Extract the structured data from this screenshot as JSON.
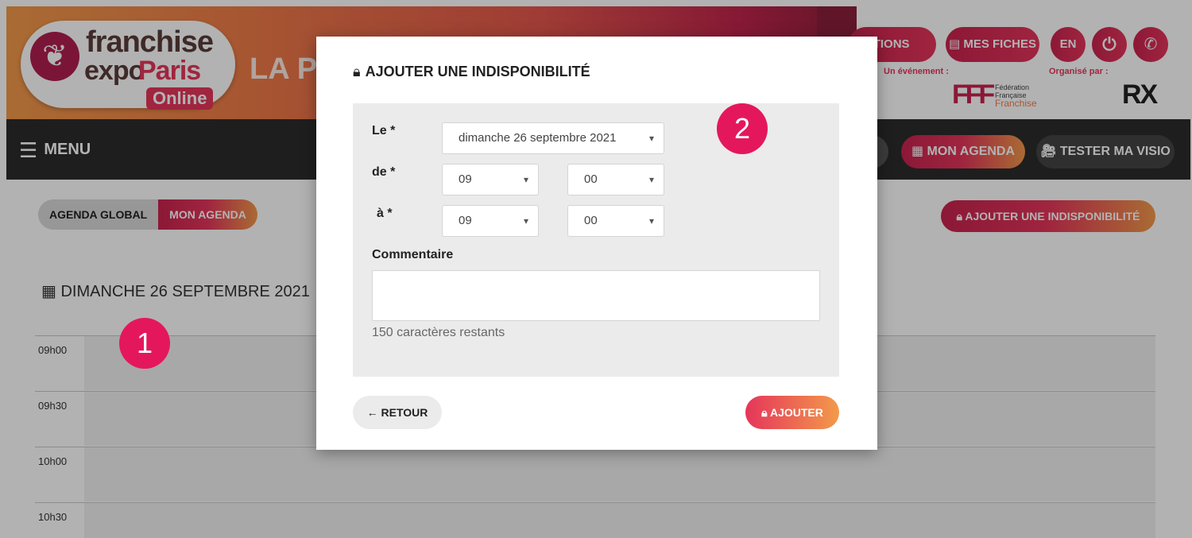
{
  "header": {
    "logo_line1": "franchise",
    "logo_line2a": "expo",
    "logo_line2b": "Paris",
    "logo_online": "Online",
    "page_title": "LA P",
    "notifications_label": "ICATIONS",
    "fiches_label": "MES FICHES",
    "lang_label": "EN",
    "event_label": "Un événement :",
    "organizer_label": "Organisé par :",
    "fff_mark": "FFF",
    "fff_line1": "Fédération",
    "fff_line2": "Française",
    "fff_line3": "Franchise",
    "rx_mark": "RX"
  },
  "navbar": {
    "menu_label": "MENU",
    "agenda_label": "MON AGENDA",
    "visio_label": "TESTER MA VISIO"
  },
  "content": {
    "tab_global": "AGENDA GLOBAL",
    "tab_mine": "MON AGENDA",
    "add_unavailability": "AJOUTER UNE INDISPONIBILITÉ",
    "day_title": "DIMANCHE 26 SEPTEMBRE 2021",
    "slots": [
      "09h00",
      "09h30",
      "10h00",
      "10h30"
    ]
  },
  "modal": {
    "title": "AJOUTER UNE INDISPONIBILITÉ",
    "label_date": "Le *",
    "date_value": "dimanche 26 septembre 2021",
    "label_from": "de *",
    "from_hour": "09",
    "from_min": "00",
    "label_to": "à *",
    "to_hour": "09",
    "to_min": "00",
    "comment_label": "Commentaire",
    "counter": "150 caractères restants",
    "back_label": "RETOUR",
    "add_label": "AJOUTER"
  },
  "annotations": {
    "badge1": "1",
    "badge2": "2"
  },
  "colors": {
    "accent_pink": "#e5355b",
    "accent_orange": "#f39a4a",
    "navbar_bg": "#2b2b2b"
  }
}
